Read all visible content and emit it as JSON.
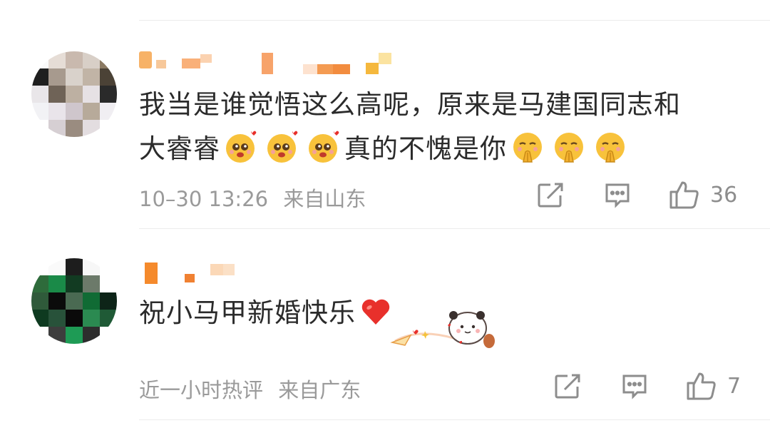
{
  "comments": [
    {
      "text_line1": "我当是谁觉悟这么高呢，原来是马建国同志和",
      "text_line2_a": "大睿睿",
      "text_line2_b": "真的不愧是你",
      "time": "10–30 13:26",
      "location": "来自山东",
      "likes": "36"
    },
    {
      "text": "祝小马甲新婚快乐",
      "time": "近一小时热评",
      "location": "来自广东",
      "likes": "7"
    }
  ],
  "icons": {
    "share": "share-icon",
    "comment": "comment-icon",
    "like": "thumbs-up-icon"
  },
  "colors": {
    "text": "#2b2b2b",
    "meta": "#9a9a9a",
    "username_orange": "#f5a04a",
    "heart": "#e8302b",
    "divider": "#ececec"
  }
}
